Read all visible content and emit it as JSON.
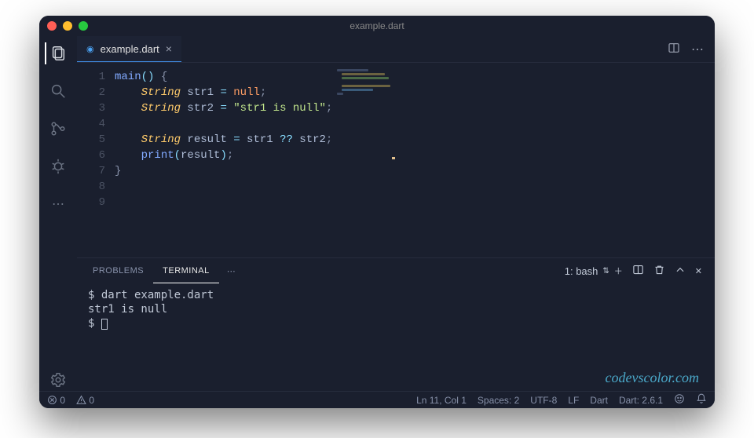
{
  "window": {
    "title": "example.dart"
  },
  "tab": {
    "filename": "example.dart"
  },
  "code": {
    "lines": [
      "1",
      "2",
      "3",
      "4",
      "5",
      "6",
      "7",
      "8",
      "9"
    ],
    "l1_fn": "main",
    "l1_open": "()",
    "l1_brace": " {",
    "indent1": "    ",
    "l2_kw": "String",
    "l2_var": " str1 ",
    "l2_eq": "=",
    "l2_null": " null",
    "l2_semi": ";",
    "l3_kw": "String",
    "l3_var": " str2 ",
    "l3_eq": "=",
    "l3_str": " \"str1 is null\"",
    "l3_semi": ";",
    "l5_kw": "String",
    "l5_var": " result ",
    "l5_eq": "=",
    "l5_rhs1": " str1 ",
    "l5_op": "??",
    "l5_rhs2": " str2",
    "l5_semi": ";",
    "l6_fn": "print",
    "l6_open": "(",
    "l6_arg": "result",
    "l6_close": ")",
    "l6_semi": ";",
    "l7_close": "}"
  },
  "panel": {
    "tabs": {
      "problems": "PROBLEMS",
      "terminal": "TERMINAL"
    },
    "picker": "1: bash"
  },
  "terminal": {
    "line1": "$ dart example.dart",
    "line2": "str1 is null",
    "line3_prompt": "$ "
  },
  "status": {
    "errors": "0",
    "warnings": "0",
    "lncol": "Ln 11, Col 1",
    "spaces": "Spaces: 2",
    "encoding": "UTF-8",
    "eol": "LF",
    "lang": "Dart",
    "sdk": "Dart: 2.6.1"
  },
  "watermark": "codevscolor.com"
}
